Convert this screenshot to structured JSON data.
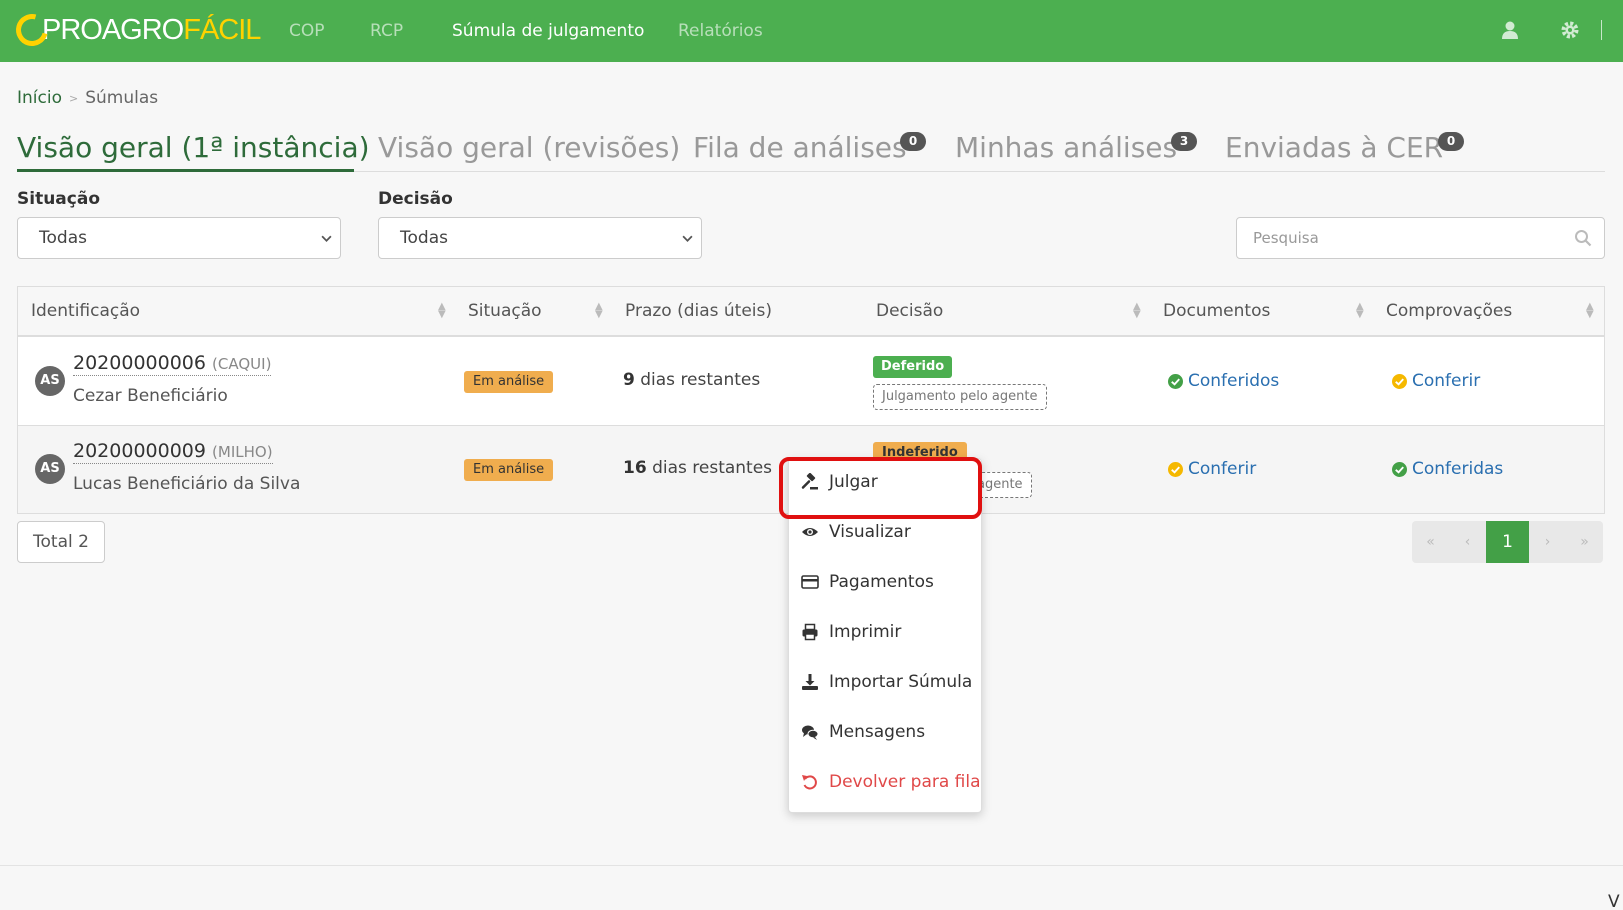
{
  "colors": {
    "brand": "#4caf50",
    "accent": "#ffd200",
    "link": "#2a6fb0",
    "danger": "#e04848",
    "warning": "#f0ad4e",
    "highlight": "#e01010"
  },
  "header": {
    "logo_part1": "PROAGRO",
    "logo_part2": "FÁCIL",
    "nav": [
      {
        "label": "COP"
      },
      {
        "label": "RCP"
      },
      {
        "label": "Súmula de julgamento"
      },
      {
        "label": "Relatórios"
      }
    ],
    "icons": [
      "user-icon",
      "gear-icon"
    ]
  },
  "breadcrumb": {
    "home": "Início",
    "separator": ">",
    "current": "Súmulas"
  },
  "tabs": [
    {
      "label": "Visão geral (1ª instância)"
    },
    {
      "label": "Visão geral (revisões)"
    },
    {
      "label": "Fila de análises",
      "badge": "0"
    },
    {
      "label": "Minhas análises",
      "badge": "3"
    },
    {
      "label": "Enviadas à CER",
      "badge": "0"
    }
  ],
  "filters": {
    "situacao": {
      "label": "Situação",
      "value": "Todas"
    },
    "decisao": {
      "label": "Decisão",
      "value": "Todas"
    },
    "search": {
      "placeholder": "Pesquisa"
    }
  },
  "table": {
    "columns": [
      "Identificação",
      "Situação",
      "Prazo (dias úteis)",
      "Decisão",
      "Documentos",
      "Comprovações"
    ],
    "rows": [
      {
        "avatar": "AS",
        "id": "20200000006",
        "crop": "(CAQUI)",
        "name": "Cezar Beneficiário",
        "situacao": "Em análise",
        "prazo_num": "9",
        "prazo_text": "dias restantes",
        "decisao": "Deferido",
        "decisao_note": "Julgamento pelo agente",
        "documentos": "Conferidos",
        "comprovacoes": "Conferir"
      },
      {
        "avatar": "AS",
        "id": "20200000009",
        "crop": "(MILHO)",
        "name": "Lucas Beneficiário da Silva",
        "situacao": "Em análise",
        "prazo_num": "16",
        "prazo_text": "dias restantes",
        "decisao": "Indeferido",
        "decisao_note": "agente",
        "documentos": "Conferir",
        "comprovacoes": "Conferidas"
      }
    ]
  },
  "total": "Total 2",
  "pagination": {
    "first": "«",
    "prev": "‹",
    "current": "1",
    "next": "›",
    "last": "»"
  },
  "context_menu": [
    {
      "label": "Julgar",
      "icon": "gavel-icon"
    },
    {
      "label": "Visualizar",
      "icon": "eye-icon"
    },
    {
      "label": "Pagamentos",
      "icon": "credit-card-icon"
    },
    {
      "label": "Imprimir",
      "icon": "printer-icon"
    },
    {
      "label": "Importar Súmula",
      "icon": "download-icon"
    },
    {
      "label": "Mensagens",
      "icon": "comments-icon"
    },
    {
      "label": "Devolver para fila",
      "icon": "undo-icon"
    }
  ],
  "footer_text": "V"
}
